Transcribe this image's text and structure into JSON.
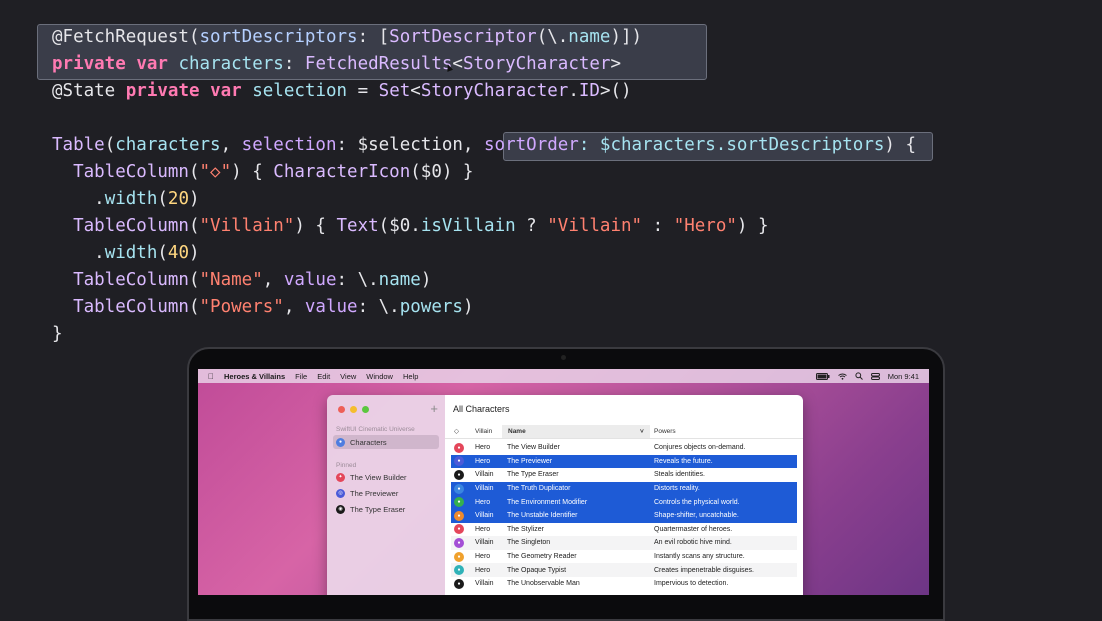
{
  "code": {
    "l1": {
      "p1": "@FetchRequest(",
      "p2": "sortDescriptors",
      "p3": ": [",
      "p4": "SortDescriptor",
      "p5": "(\\.",
      "p6": "name",
      "p7": ")])"
    },
    "l2": {
      "p1": "private",
      "p2": " ",
      "p3": "var",
      "p4": " ",
      "p5": "characters",
      "p6": ": ",
      "p7": "FetchedResults",
      "p8": "<",
      "p9": "StoryCharacter",
      "p10": ">"
    },
    "l3": {
      "p1": "@State ",
      "p2": "private",
      "p3": " ",
      "p4": "var",
      "p5": " ",
      "p6": "selection",
      "p7": " = ",
      "p8": "Set",
      "p9": "<",
      "p10": "StoryCharacter",
      "p11": ".",
      "p12": "ID",
      "p13": ">()"
    },
    "l4": {
      "p1": "Table",
      "p2": "(",
      "p3": "characters",
      "p4": ", ",
      "p5": "selection",
      "p6": ": $selection, ",
      "p7": "sortOrder",
      "p8": ": $characters.sortDescriptors",
      "p9": ") {"
    },
    "l5": {
      "p1": "  TableColumn",
      "p2": "(",
      "p3": "\"◇\"",
      "p4": ") { ",
      "p5": "CharacterIcon",
      "p6": "($0) }"
    },
    "l6": {
      "p1": "    .",
      "p2": "width",
      "p3": "(",
      "p4": "20",
      "p5": ")"
    },
    "l7": {
      "p1": "  TableColumn",
      "p2": "(",
      "p3": "\"Villain\"",
      "p4": ") { ",
      "p5": "Text",
      "p6": "($0.",
      "p7": "isVillain",
      "p8": " ? ",
      "p9": "\"Villain\"",
      "p10": " : ",
      "p11": "\"Hero\"",
      "p12": ") }"
    },
    "l8": {
      "p1": "    .",
      "p2": "width",
      "p3": "(",
      "p4": "40",
      "p5": ")"
    },
    "l9": {
      "p1": "  TableColumn",
      "p2": "(",
      "p3": "\"Name\"",
      "p4": ", ",
      "p5": "value",
      "p6": ": \\.",
      "p7": "name",
      "p8": ")"
    },
    "l10": {
      "p1": "  TableColumn",
      "p2": "(",
      "p3": "\"Powers\"",
      "p4": ", ",
      "p5": "value",
      "p6": ": \\.",
      "p7": "powers",
      "p8": ")"
    },
    "l11": {
      "p1": "}"
    }
  },
  "menubar": {
    "apple": "",
    "app_name": "Heroes & Villains",
    "items": [
      "File",
      "Edit",
      "View",
      "Window",
      "Help"
    ],
    "clock": "Mon 9:41"
  },
  "sidebar": {
    "section_title": "SwiftUI Cinematic Universe",
    "characters_label": "Characters",
    "pinned_title": "Pinned",
    "pinned": [
      {
        "label": "The View Builder",
        "color": "#e4465a"
      },
      {
        "label": "The Previewer",
        "color": "#4b5ad8"
      },
      {
        "label": "The Type Eraser",
        "color": "#1a1a1a"
      }
    ]
  },
  "window": {
    "title": "All Characters",
    "headers": {
      "icon": "◇",
      "villain": "Villain",
      "name": "Name",
      "powers": "Powers",
      "sort": "˅"
    }
  },
  "rows": [
    {
      "role": "Hero",
      "name": "The View Builder",
      "power": "Conjures objects on-demand.",
      "color": "#e4465a",
      "selected": false
    },
    {
      "role": "Hero",
      "name": "The Previewer",
      "power": "Reveals the future.",
      "color": "#4b5ad8",
      "selected": true
    },
    {
      "role": "Villain",
      "name": "The Type Eraser",
      "power": "Steals identities.",
      "color": "#1a1a1a",
      "selected": false
    },
    {
      "role": "Villain",
      "name": "The Truth Duplicator",
      "power": "Distorts reality.",
      "color": "#3a86e0",
      "selected": true
    },
    {
      "role": "Hero",
      "name": "The Environment Modifier",
      "power": "Controls the physical world.",
      "color": "#35b04e",
      "selected": true
    },
    {
      "role": "Villain",
      "name": "The Unstable Identifier",
      "power": "Shape-shifter, uncatchable.",
      "color": "#ef8a2d",
      "selected": true
    },
    {
      "role": "Hero",
      "name": "The Stylizer",
      "power": "Quartermaster of heroes.",
      "color": "#e4465a",
      "selected": false
    },
    {
      "role": "Villain",
      "name": "The Singleton",
      "power": "An evil robotic hive mind.",
      "color": "#a44fd6",
      "selected": false
    },
    {
      "role": "Hero",
      "name": "The Geometry Reader",
      "power": "Instantly scans any structure.",
      "color": "#f0a12d",
      "selected": false
    },
    {
      "role": "Hero",
      "name": "The Opaque Typist",
      "power": "Creates impenetrable disguises.",
      "color": "#2fb2b8",
      "selected": false
    },
    {
      "role": "Villain",
      "name": "The Unobservable Man",
      "power": "Impervious to detection.",
      "color": "#1a1a1a",
      "selected": false
    }
  ]
}
